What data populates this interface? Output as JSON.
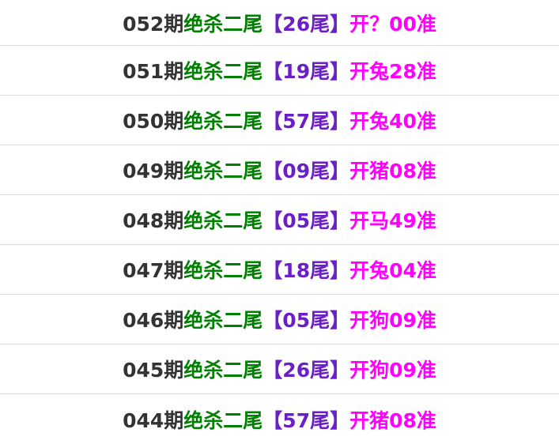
{
  "colors": {
    "period": "#333333",
    "label": "#008000",
    "pick": "#6a1fc7",
    "result": "#ff00ff"
  },
  "rows": [
    {
      "period": "052期",
      "label": "绝杀二尾",
      "pick": "【26尾】",
      "result": "开？00准"
    },
    {
      "period": "051期",
      "label": "绝杀二尾",
      "pick": "【19尾】",
      "result": "开兔28准"
    },
    {
      "period": "050期",
      "label": "绝杀二尾",
      "pick": "【57尾】",
      "result": "开兔40准"
    },
    {
      "period": "049期",
      "label": "绝杀二尾",
      "pick": "【09尾】",
      "result": "开猪08准"
    },
    {
      "period": "048期",
      "label": "绝杀二尾",
      "pick": "【05尾】",
      "result": "开马49准"
    },
    {
      "period": "047期",
      "label": "绝杀二尾",
      "pick": "【18尾】",
      "result": "开兔04准"
    },
    {
      "period": "046期",
      "label": "绝杀二尾",
      "pick": "【05尾】",
      "result": "开狗09准"
    },
    {
      "period": "045期",
      "label": "绝杀二尾",
      "pick": "【26尾】",
      "result": "开狗09准"
    },
    {
      "period": "044期",
      "label": "绝杀二尾",
      "pick": "【57尾】",
      "result": "开猪08准"
    }
  ]
}
